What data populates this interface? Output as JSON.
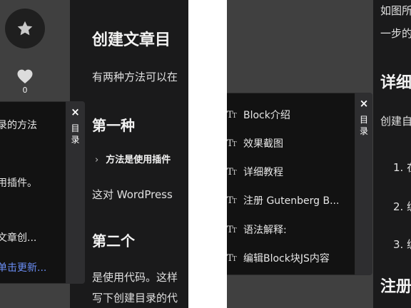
{
  "left": {
    "like_count": "0",
    "toc_tab": {
      "close": "×",
      "label": "目录"
    },
    "toc_items": [
      {
        "label": "目录的方法",
        "active": false
      },
      {
        "label": "使用插件。",
        "active": false
      },
      {
        "label": "为文章创...",
        "active": false
      },
      {
        "label": "已单击更新...",
        "active": true
      }
    ],
    "article": {
      "title": "创建文章目",
      "intro": "有两种方法可以在",
      "section1": "第一种",
      "bullet": "方法是使用插件",
      "para1": "这对 WordPress",
      "section2": "第二个",
      "para2_line1": "是使用代码。这样",
      "para2_line2": "写下创建目录的代"
    }
  },
  "right": {
    "toc_tab": {
      "close": "×",
      "label": "目录"
    },
    "toc_items": [
      {
        "label": "Block介绍",
        "icon": "text-type-icon"
      },
      {
        "label": "效果截图",
        "icon": "text-type-icon"
      },
      {
        "label": "详细教程",
        "icon": "text-type-icon"
      },
      {
        "label": "注册 Gutenberg B...",
        "icon": "text-type-icon"
      },
      {
        "label": "语法解释:",
        "icon": "text-type-icon"
      },
      {
        "label": "编辑Block块JS内容",
        "icon": "text-type-icon"
      }
    ],
    "article": {
      "line1": "如图所",
      "line2": "一步的",
      "heading1": "详细",
      "para": "创建自",
      "ol1": "1. 在",
      "ol2": "2. 编",
      "ol3": "3. 编",
      "heading2": "注册"
    }
  },
  "colors": {
    "sidebar": "#404040",
    "article_bg": "#1a1a1b",
    "toc_bg": "#121212",
    "link_active": "#6b8ef5"
  }
}
